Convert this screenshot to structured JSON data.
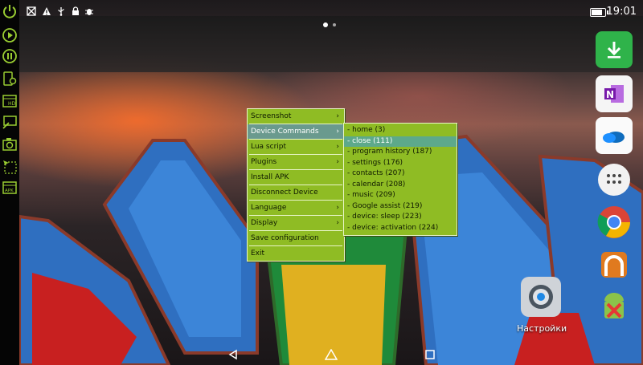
{
  "statusbar": {
    "time": "19:01",
    "icons": [
      "no-sim-icon",
      "warning-icon",
      "usb-icon",
      "lock-icon",
      "bug-icon"
    ]
  },
  "left_toolbar": {
    "buttons": [
      "power-icon",
      "play-icon",
      "pause-icon",
      "settings-phone-icon",
      "hd-icon",
      "screen-cast-icon",
      "camera-icon",
      "cursor-select-icon",
      "apk-icon"
    ]
  },
  "context_menu": {
    "items": [
      {
        "label": "Screenshot",
        "submenu": true
      },
      {
        "label": "Device Commands",
        "submenu": true
      },
      {
        "label": "Lua script",
        "submenu": true
      },
      {
        "label": "Plugins",
        "submenu": true
      },
      {
        "label": "Install APK",
        "submenu": false
      },
      {
        "label": "Disconnect Device",
        "submenu": false
      },
      {
        "label": "Language",
        "submenu": true
      },
      {
        "label": "Display",
        "submenu": true
      },
      {
        "label": "Save configuration",
        "submenu": false
      },
      {
        "label": "Exit",
        "submenu": false
      }
    ],
    "arrow": "›",
    "active_item": "Device Commands"
  },
  "device_commands_submenu": {
    "items": [
      "- home (3)",
      "- close (111)",
      "- program history (187)",
      "- settings (176)",
      "- contacts (207)",
      "- calendar (208)",
      "- music (209)",
      "- Google assist (219)",
      "- device: sleep (223)",
      "- device: activation (224)"
    ],
    "selected_item": "- close (111)"
  },
  "home_screen": {
    "dock_apps": [
      "download-app-icon",
      "onenote-app-icon",
      "onedrive-app-icon",
      "app-drawer-icon",
      "chrome-app-icon",
      "vpn-app-icon",
      "android-debug-app-icon"
    ],
    "settings_app_label": "Настройки"
  },
  "navbar": {
    "buttons": [
      "back-icon",
      "home-icon",
      "recents-icon"
    ]
  },
  "colors": {
    "menu_bg": "#8fbc24",
    "menu_border": "#e8f5c8",
    "menu_highlight": "#5da98b"
  }
}
